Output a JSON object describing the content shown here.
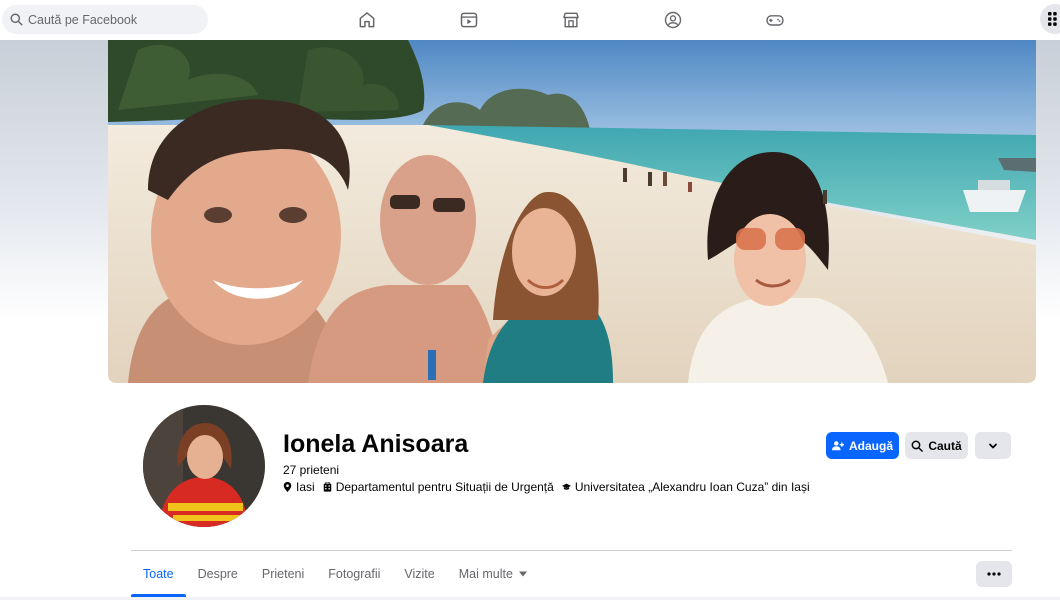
{
  "topbar": {
    "search_placeholder": "Caută pe Facebook",
    "nav_icons": [
      "home-icon",
      "video-icon",
      "marketplace-icon",
      "groups-icon",
      "gaming-icon"
    ],
    "menu_icon": "grid-menu-icon"
  },
  "profile": {
    "name": "Ionela Anisoara",
    "friends": "27 prieteni",
    "location": "Iasi",
    "workplace": "Departamentul pentru Situații de Urgență",
    "education": "Universitatea „Alexandru Ioan Cuza” din Iași"
  },
  "actions": {
    "add_label": "Adaugă",
    "search_label": "Caută"
  },
  "tabs": [
    {
      "label": "Toate",
      "active": true
    },
    {
      "label": "Despre",
      "active": false
    },
    {
      "label": "Prieteni",
      "active": false
    },
    {
      "label": "Fotografii",
      "active": false
    },
    {
      "label": "Vizite",
      "active": false
    },
    {
      "label": "Mai multe",
      "active": false
    }
  ],
  "colors": {
    "accent": "#0866ff",
    "secondary_button": "#e4e6eb",
    "muted_text": "#65676b"
  }
}
